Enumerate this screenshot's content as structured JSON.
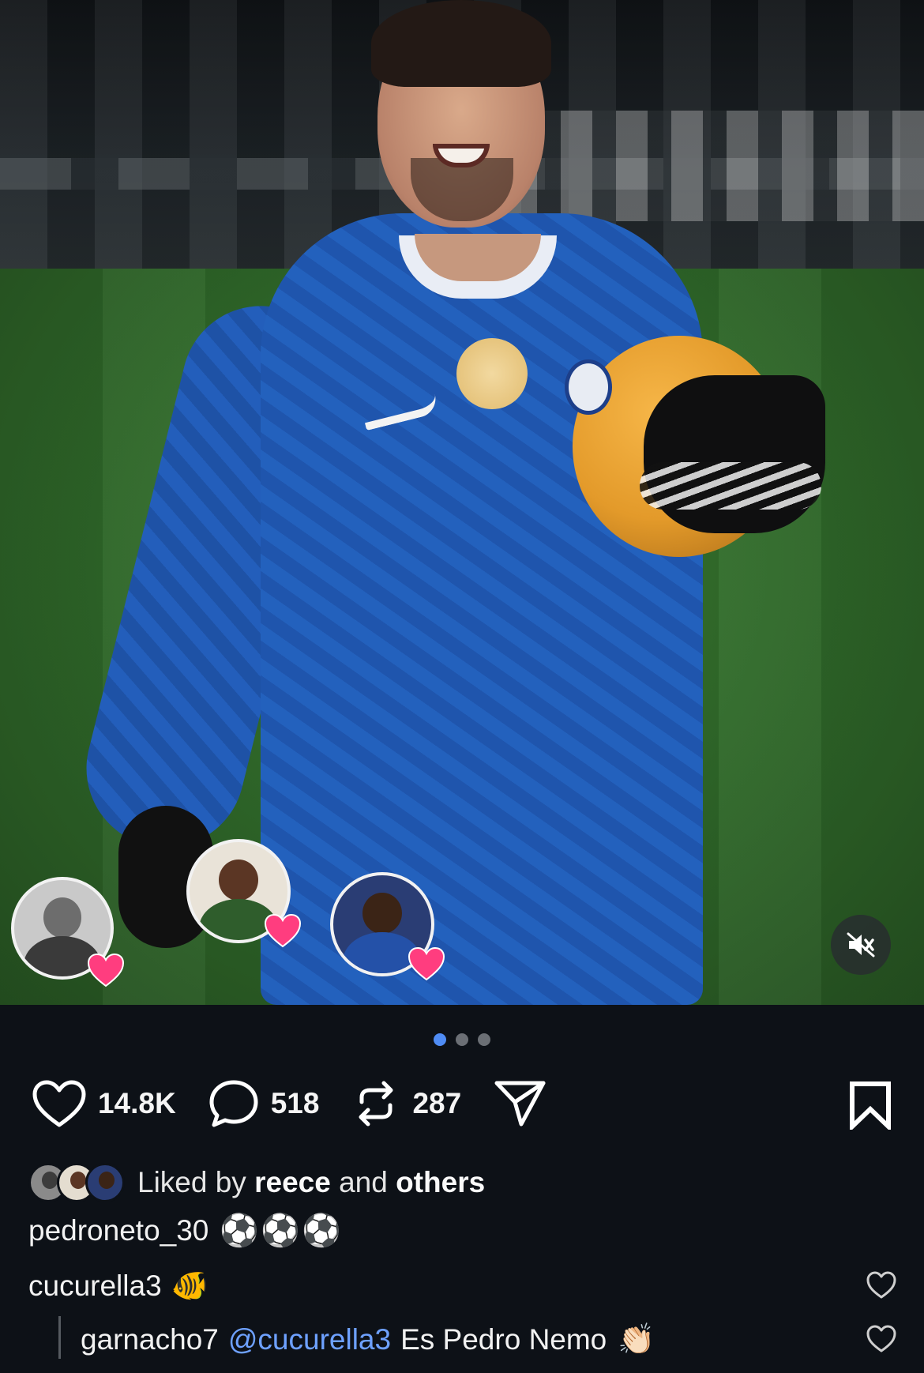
{
  "post": {
    "carousel": {
      "count": 3,
      "active_index": 0
    },
    "actions": {
      "likes": "14.8K",
      "comments": "518",
      "reposts": "287"
    },
    "liked_by": {
      "prefix": "Liked by",
      "user": "reece",
      "middle": "and",
      "suffix": "others"
    },
    "caption": {
      "username": "pedroneto_30",
      "emoji": "⚽⚽⚽"
    },
    "comments": [
      {
        "username": "cucurella3",
        "emoji": "🐠"
      },
      {
        "username": "garnacho7",
        "mention": "@cucurella3",
        "text": "Es Pedro Nemo",
        "emoji": "👏🏻"
      }
    ]
  },
  "icons": {
    "like": "heart-outline-icon",
    "comment": "speech-bubble-icon",
    "repost": "repost-arrows-icon",
    "share": "paper-plane-icon",
    "save": "bookmark-icon",
    "mute": "speaker-muted-icon",
    "reaction": "heart-icon"
  },
  "colors": {
    "background": "#0d1117",
    "text": "#f2f2f2",
    "mention": "#6ea1ff",
    "active_dot": "#4f8cf5",
    "inactive_dot": "#6b6f75",
    "reaction_heart": "#ff3d7f"
  }
}
